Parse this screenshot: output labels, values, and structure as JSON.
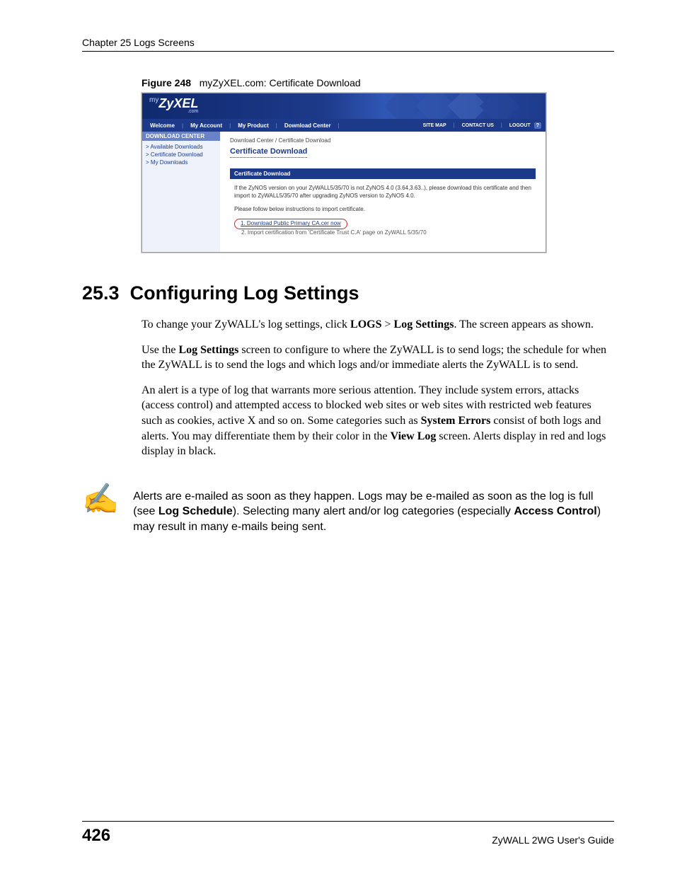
{
  "header": {
    "chapter": "Chapter 25 Logs Screens"
  },
  "figure": {
    "label": "Figure 248",
    "caption": "myZyXEL.com: Certificate Download"
  },
  "screenshot": {
    "logo": {
      "prefix": "my",
      "brand": "ZyXEL",
      "suffix": ".com"
    },
    "nav_left": [
      "Welcome",
      "My Account",
      "My Product",
      "Download Center"
    ],
    "nav_right": [
      "SITE MAP",
      "CONTACT US",
      "LOGOUT",
      "?"
    ],
    "sidebar": {
      "header": "DOWNLOAD CENTER",
      "items": [
        "Available Downloads",
        "Certificate Download",
        "My Downloads"
      ]
    },
    "main": {
      "breadcrumb": "Download Center / Certificate Download",
      "title": "Certificate Download",
      "section_bar": "Certificate Download",
      "para1": "If the ZyNOS version on your ZyWALL5/35/70 is not ZyNOS 4.0 (3.64,3.63..), please download this certificate and then import to ZyWALL5/35/70 after upgrading ZyNOS version to ZyNOS 4.0.",
      "para2": "Please follow below instructions to import certificate.",
      "step1_link": "1. Download Public Primary CA.cer now",
      "step2": "2. Import certification from 'Certificate Trust C.A' page on ZyWALL 5/35/70"
    }
  },
  "section": {
    "number": "25.3",
    "title": "Configuring Log Settings"
  },
  "paragraphs": {
    "p1_a": "To change your ZyWALL's log settings, click ",
    "p1_b1": "LOGS",
    "p1_mid": " > ",
    "p1_b2": "Log Settings",
    "p1_c": ". The screen appears as shown.",
    "p2_a": "Use the ",
    "p2_b": "Log Settings",
    "p2_c": " screen to configure to where the ZyWALL is to send logs; the schedule for when the ZyWALL is to send the logs and which logs and/or immediate alerts the ZyWALL is to send.",
    "p3_a": "An alert is a type of log that warrants more serious attention. They include system errors, attacks (access control) and attempted access to blocked web sites or web sites with restricted web features such as cookies, active X and so on. Some categories such as ",
    "p3_b1": "System Errors",
    "p3_mid": " consist of both logs and alerts. You may differentiate them by their color in the ",
    "p3_b2": "View Log",
    "p3_c": " screen. Alerts display in red and logs display in black."
  },
  "note": {
    "icon": "✍",
    "t1": "Alerts are e-mailed as soon as they happen. Logs may be e-mailed as soon as the log is full (see ",
    "b1": "Log Schedule",
    "t2": "). Selecting many alert and/or log categories (especially ",
    "b2": "Access Control",
    "t3": ") may result in many e-mails being sent."
  },
  "footer": {
    "page": "426",
    "guide": "ZyWALL 2WG User's Guide"
  }
}
